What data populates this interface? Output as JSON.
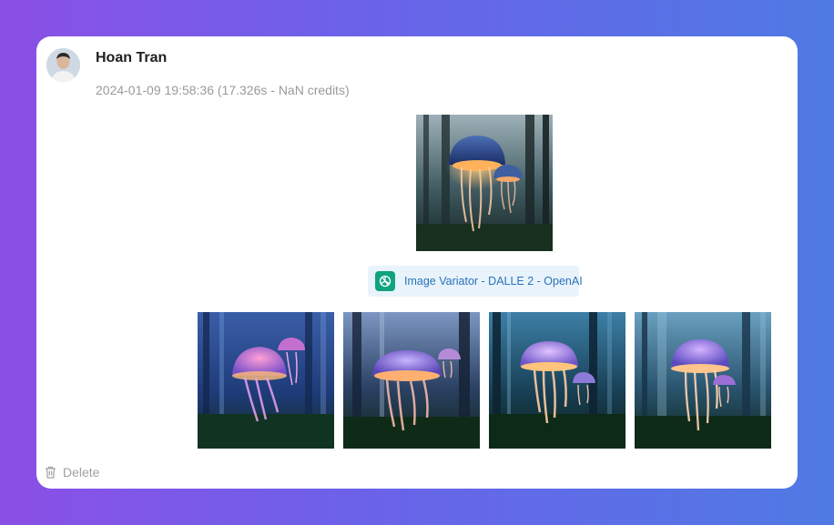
{
  "message": {
    "user_name": "Hoan Tran",
    "avatar_icon": "user-avatar",
    "timestamp": "2024-01-09 19:58:36 (17.326s - NaN credits)"
  },
  "source_image": {
    "subject": "glowing jellyfish in dark forest"
  },
  "model_chip": {
    "icon": "openai-logo-icon",
    "label": "Image Variator - DALLE 2 - OpenAI",
    "icon_color": "#10a37f",
    "text_color": "#2a73b8",
    "background_color": "#e8f3fc"
  },
  "variations": [
    {
      "index": 1
    },
    {
      "index": 2
    },
    {
      "index": 3
    },
    {
      "index": 4
    }
  ],
  "actions": {
    "delete_label": "Delete",
    "delete_icon": "trash-icon"
  },
  "colors": {
    "background_gradient_start": "#8b4fe6",
    "background_gradient_end": "#4f7ae3",
    "card": "#ffffff"
  }
}
